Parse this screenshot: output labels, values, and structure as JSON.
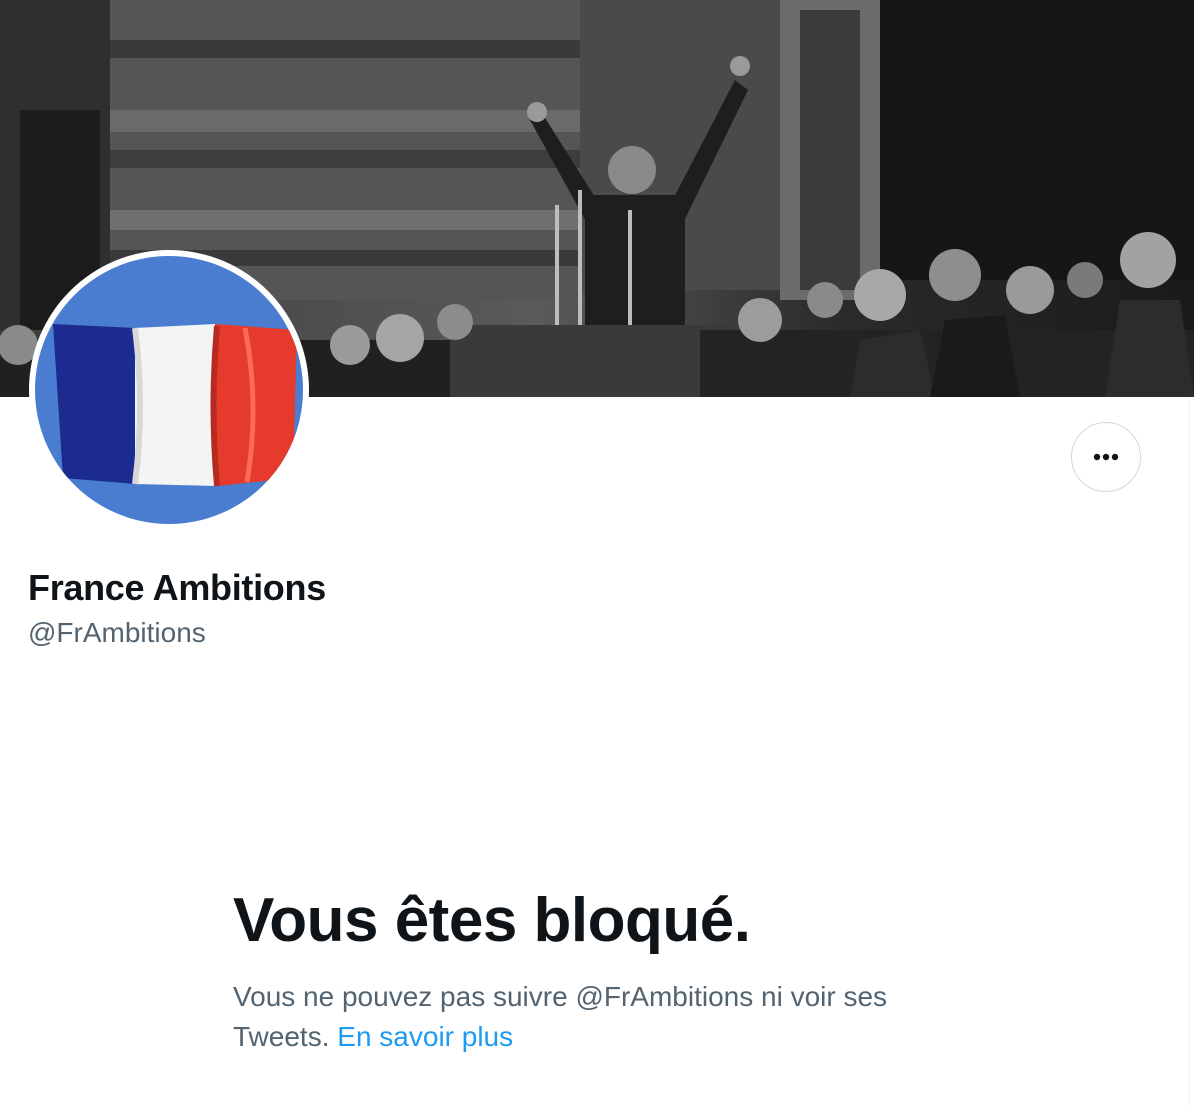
{
  "profile": {
    "display_name": "France Ambitions",
    "handle": "@FrAmbitions",
    "banner_icon": "banner-photo",
    "avatar_icon": "french-flag"
  },
  "actions": {
    "more_icon": "more-horizontal-icon"
  },
  "blocked": {
    "title": "Vous êtes bloqué.",
    "description": "Vous ne pouvez pas suivre @FrAmbitions ni voir ses Tweets.",
    "learn_more": "En savoir plus"
  },
  "colors": {
    "text_primary": "#0f1419",
    "text_secondary": "#536471",
    "link": "#1d9bf0",
    "border": "#cfd9de",
    "flag_blue": "#1b2b8f",
    "flag_white": "#f4f4f4",
    "flag_red": "#e63a2c",
    "sky_blue": "#4a7dcf"
  }
}
